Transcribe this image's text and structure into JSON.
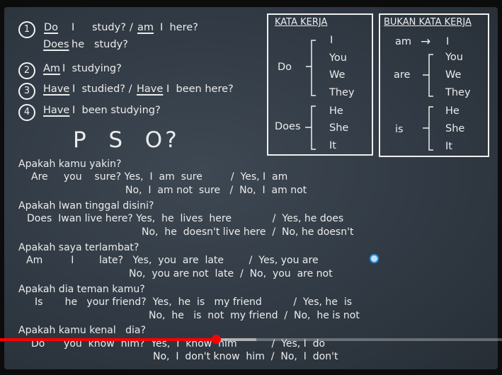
{
  "items": {
    "n1": "1",
    "n2": "2",
    "n3": "3",
    "n4": "4",
    "q1_do": "Do",
    "q1_i": "I",
    "q1_study": "study?",
    "q1_slash": "/",
    "q1_am": "am",
    "q1_ihere": "I  here?",
    "q1b_does": "Does",
    "q1b_rest": "he   study?",
    "q2_am": "Am",
    "q2_rest": "I  studying?",
    "q3_have1": "Have",
    "q3_mid": "I  studied? /",
    "q3_have2": "Have",
    "q3_end": "I  been here?",
    "q4_have": "Have",
    "q4_rest": "I  been studying?"
  },
  "pso": "P  S  O?",
  "box1": {
    "title": "KATA KERJA",
    "do": "Do",
    "does": "Does",
    "group1": [
      "I",
      "You",
      "We",
      "They"
    ],
    "group2": [
      "He",
      "She",
      "It"
    ]
  },
  "box2": {
    "title": "BUKAN KATA KERJA",
    "am": "am",
    "arrow": "→",
    "am_i": "I",
    "are": "are",
    "are_group": [
      "You",
      "We",
      "They"
    ],
    "is": "is",
    "is_group": [
      "He",
      "She",
      "It"
    ]
  },
  "examples": [
    {
      "q": "Apakah kamu yakin?",
      "l1": "Are     you    sure? Yes,  I  am  sure         /  Yes, I  am",
      "l2": "No,  I  am not  sure   /  No,  I  am not"
    },
    {
      "q": "Apakah Iwan tinggal disini?",
      "l1": "Does  Iwan live here? Yes,  he  lives  here             /  Yes, he does",
      "l2": "No,  he  doesn't live here  /  No, he doesn't"
    },
    {
      "q": "Apakah saya terlambat?",
      "l1": "Am         I        late?   Yes,  you  are  late        /  Yes, you are",
      "l2": "No,  you are not  late  /  No,  you  are not"
    },
    {
      "q": "Apakah dia teman kamu?",
      "l1": "Is       he   your friend?  Yes,  he  is   my friend          /  Yes, he  is",
      "l2": "No,  he   is  not  my friend  /  No,  he is not"
    },
    {
      "q": "Apakah kamu kenal   dia?",
      "l1": "Do      you  know  him?  Yes,  I  know  him           /  Yes, I  do",
      "l2": "No,  I  don't know  him  /  No,  I  don't"
    }
  ],
  "player": {
    "progress_fraction": 0.43,
    "buffer_fraction": 0.51
  }
}
